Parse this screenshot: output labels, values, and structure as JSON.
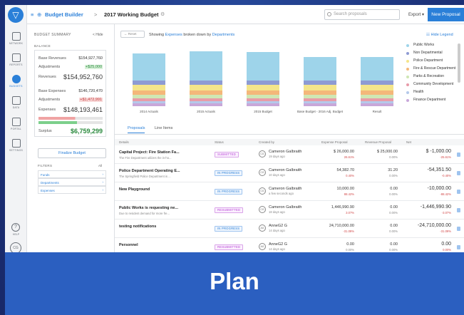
{
  "app": {
    "breadcrumb_root": "Budget Builder",
    "breadcrumb_sep": ">",
    "breadcrumb_current": "2017 Working Budget"
  },
  "topbar": {
    "search_placeholder": "Search proposals",
    "export_label": "Export",
    "new_proposal_label": "New Proposal"
  },
  "rail": {
    "items": [
      {
        "label": "NETWORK",
        "icon": "network-icon"
      },
      {
        "label": "REPORTS",
        "icon": "reports-icon"
      },
      {
        "label": "BUDGETS",
        "icon": "budgets-icon",
        "active": true
      },
      {
        "label": "DATA",
        "icon": "data-icon"
      },
      {
        "label": "PORTAL",
        "icon": "portal-icon"
      },
      {
        "label": "SETTINGS",
        "icon": "settings-icon"
      }
    ],
    "help_label": "HELP",
    "avatar_initials": "CG"
  },
  "summary": {
    "title": "BUDGET SUMMARY",
    "hide_label": "< Hide",
    "balance_label": "BALANCE",
    "base_revenues_label": "Base Revenues",
    "base_revenues": "$154,927,760",
    "adjustments1_label": "Adjustments",
    "adjustments1": "+$25,000",
    "revenues_label": "Revenues",
    "revenues": "$154,952,760",
    "base_expenses_label": "Base Expenses",
    "base_expenses": "$146,720,470",
    "adjustments2_label": "Adjustments",
    "adjustments2": "+$1,472,991",
    "expenses_label": "Expenses",
    "expenses": "$148,193,461",
    "surplus_label": "Surplus",
    "surplus": "$6,759,299",
    "finalize_label": "Finalize Budget",
    "filters_label": "FILTERS",
    "filters_all": "All",
    "filters": [
      "Funds",
      "Departments",
      "Expenses"
    ]
  },
  "chart_header": {
    "reset_label": "Reset",
    "showing_prefix": "Showing",
    "showing_metric": "Expenses",
    "showing_mid": "broken down by",
    "showing_dim": "Departments",
    "hide_legend": "Hide Legend"
  },
  "legend": [
    {
      "name": "Public Works",
      "color": "#9ed4ea"
    },
    {
      "name": "Non Departmental",
      "color": "#8e9bd3"
    },
    {
      "name": "Police Department",
      "color": "#f4e58a"
    },
    {
      "name": "Fire & Rescue Department",
      "color": "#f4b77a"
    },
    {
      "name": "Parks & Recreation",
      "color": "#cfe7b4"
    },
    {
      "name": "Community Development",
      "color": "#e89ba8"
    },
    {
      "name": "Health",
      "color": "#b4c9ea"
    },
    {
      "name": "Finance Department",
      "color": "#c8a7d9"
    }
  ],
  "chart_data": {
    "type": "bar",
    "stacked": true,
    "categories": [
      "2014 Actuals",
      "2015 Actuals",
      "2015 Budget",
      "Base Budget - 2016 Adj. Budget",
      "Result"
    ],
    "series": [
      {
        "name": "Finance Department",
        "values": [
          4,
          4,
          4,
          4,
          4
        ]
      },
      {
        "name": "Health",
        "values": [
          3,
          3,
          3,
          3,
          3
        ]
      },
      {
        "name": "Community Development",
        "values": [
          4,
          4,
          4,
          4,
          4
        ]
      },
      {
        "name": "Parks & Recreation",
        "values": [
          5,
          5,
          5,
          5,
          5
        ]
      },
      {
        "name": "Fire & Rescue Department",
        "values": [
          6,
          6,
          6,
          6,
          6
        ]
      },
      {
        "name": "Police Department",
        "values": [
          8,
          8,
          8,
          8,
          8
        ]
      },
      {
        "name": "Non Departmental",
        "values": [
          6,
          6,
          6,
          6,
          6
        ]
      },
      {
        "name": "Public Works",
        "values": [
          38,
          41,
          40,
          33,
          33
        ]
      }
    ]
  },
  "tabs": [
    "Proposals",
    "Line Items"
  ],
  "table": {
    "headers": [
      "Details",
      "Status",
      "Created by",
      "Expense Proposal",
      "Revenue Proposal",
      "Net"
    ],
    "rows": [
      {
        "title": "Capital Project: Fire Station Fa...",
        "sub": "The Fire Department utilizes the in-ho...",
        "status": "SUBMITTED",
        "st": "sub",
        "initials": "CG",
        "by": "Cameron Galbraith",
        "ago": "19 days ago",
        "exp": "$ 26,000.00",
        "exp_pct": "26.61%",
        "exp_red": true,
        "rev": "$ 25,000.00",
        "rev_pct": "0.00%",
        "net": "$ -1,000.00",
        "net_pct": "-25.61%"
      },
      {
        "title": "Police Department Operating E...",
        "sub": "The Springfield Police Department is ...",
        "status": "IN PROGRESS",
        "st": "prog",
        "initials": "CG",
        "by": "Cameron Galbraith",
        "ago": "10 days ago",
        "exp": "54,382.70",
        "exp_pct": "0.40%",
        "exp_red": true,
        "rev": "31.20",
        "rev_pct": "0.00%",
        "net": "-54,351.50",
        "net_pct": "-0.40%"
      },
      {
        "title": "New Playground",
        "sub": "",
        "status": "IN PROGRESS",
        "st": "prog",
        "initials": "CG",
        "by": "Cameron Galbraith",
        "ago": "a few seconds ago",
        "exp": "10,000.00",
        "exp_pct": "88.42%",
        "exp_red": true,
        "rev": "0.00",
        "rev_pct": "0.00%",
        "net": "-10,000.00",
        "net_pct": "-88.42%"
      },
      {
        "title": "Public Works is requesting ne...",
        "sub": "Due to resident demand for more fre...",
        "status": "RESUBMITTED",
        "st": "resub",
        "initials": "CG",
        "by": "Cameron Galbraith",
        "ago": "18 days ago",
        "exp": "1,446,990.90",
        "exp_pct": "3.07%",
        "exp_red": true,
        "rev": "0.00",
        "rev_pct": "0.00%",
        "net": "-1,446,990.90",
        "net_pct": "-3.07%"
      },
      {
        "title": "testing notifications",
        "sub": "",
        "status": "IN PROGRESS",
        "st": "prog",
        "initials": "AG",
        "by": "AnneG2 G",
        "ago": "14 days ago",
        "exp": "24,710,000.00",
        "exp_pct": "-31.09%",
        "exp_red": true,
        "rev": "0.00",
        "rev_pct": "0.00%",
        "net": "-24,710,000.00",
        "net_pct": "-31.09%"
      },
      {
        "title": "Personnel",
        "sub": "",
        "status": "RESUBMITTED",
        "st": "resub",
        "initials": "AG",
        "by": "AnneG2 G",
        "ago": "14 days ago",
        "exp": "0.00",
        "exp_pct": "0.00%",
        "exp_red": false,
        "rev": "0.00",
        "rev_pct": "0.00%",
        "net": "0.00",
        "net_pct": "0.00%"
      }
    ]
  },
  "banner": {
    "text": "Plan"
  }
}
